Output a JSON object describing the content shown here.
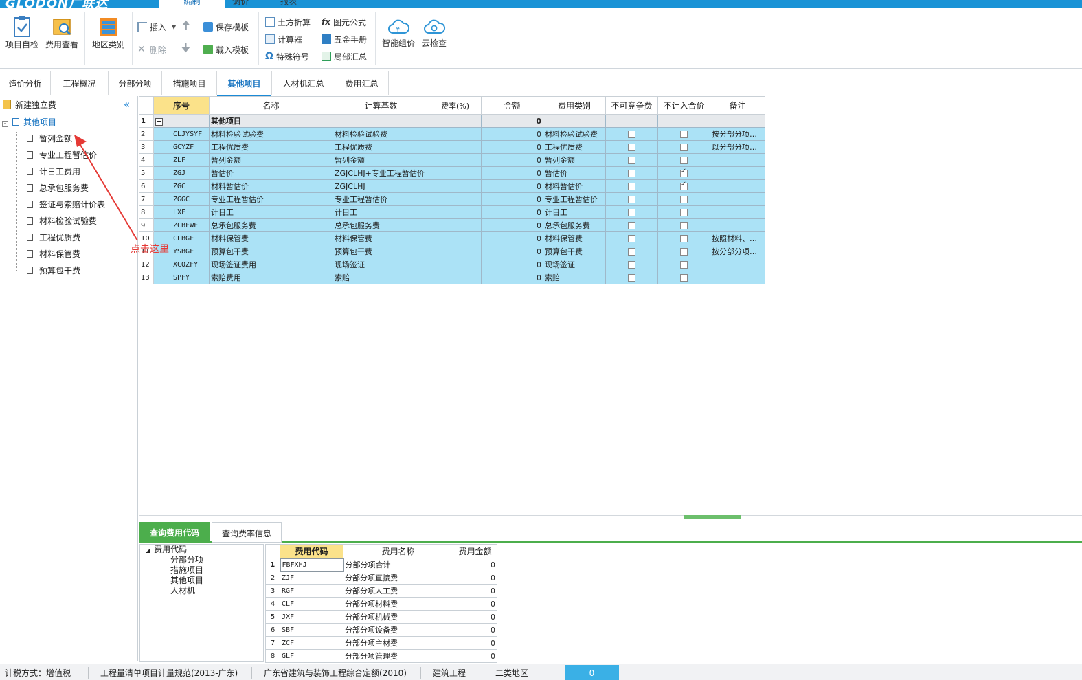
{
  "app": {
    "logo": "GLODON广联达",
    "menu_tabs": [
      "编制",
      "调价",
      "报表"
    ],
    "active_menu_tab": "编制"
  },
  "ribbon": {
    "project_check": "项目自检",
    "fee_view": "费用查看",
    "region_category": "地区类别",
    "insert": "插入",
    "delete": "删除",
    "save_template": "保存模板",
    "load_template": "载入模板",
    "earthwork": "土方折算",
    "calculator": "计算器",
    "special_symbol": "特殊符号",
    "figure_formula": "图元公式",
    "hardware_manual": "五金手册",
    "partial_summary": "局部汇总",
    "smart_pricing": "智能组价",
    "cloud_check": "云检查"
  },
  "nav_tabs": [
    "造价分析",
    "工程概况",
    "分部分项",
    "措施项目",
    "其他项目",
    "人材机汇总",
    "费用汇总"
  ],
  "active_nav_tab": "其他项目",
  "left_tree": {
    "new_fee": "新建独立费",
    "root": "其他项目",
    "children": [
      "暂列金额",
      "专业工程暂估价",
      "计日工费用",
      "总承包服务费",
      "签证与索赔计价表",
      "材料检验试验费",
      "工程优质费",
      "材料保管费",
      "预算包干费"
    ]
  },
  "annotation": "点击这里",
  "main_table": {
    "headers": [
      "序号",
      "名称",
      "计算基数",
      "费率(%)",
      "金额",
      "费用类别",
      "不可竞争费",
      "不计入合价",
      "备注"
    ],
    "row1": {
      "rn": "1",
      "name": "其他项目",
      "amount": "0"
    },
    "rows": [
      {
        "rn": "2",
        "code": "CLJYSYF",
        "name": "材料检验试验费",
        "base": "材料检验试验费",
        "amount": "0",
        "category": "材料检验试验费",
        "nc": false,
        "ni": false,
        "note": "按分部分项…"
      },
      {
        "rn": "3",
        "code": "GCYZF",
        "name": "工程优质费",
        "base": "工程优质费",
        "amount": "0",
        "category": "工程优质费",
        "nc": false,
        "ni": false,
        "note": "以分部分项…"
      },
      {
        "rn": "4",
        "code": "ZLF",
        "name": "暂列金额",
        "base": "暂列金额",
        "amount": "0",
        "category": "暂列金额",
        "nc": false,
        "ni": false,
        "note": ""
      },
      {
        "rn": "5",
        "code": "ZGJ",
        "name": "暂估价",
        "base": "ZGJCLHJ+专业工程暂估价",
        "amount": "0",
        "category": "暂估价",
        "nc": false,
        "ni": true,
        "note": ""
      },
      {
        "rn": "6",
        "code": "ZGC",
        "name": "材料暂估价",
        "base": "ZGJCLHJ",
        "amount": "0",
        "category": "材料暂估价",
        "nc": false,
        "ni": true,
        "note": ""
      },
      {
        "rn": "7",
        "code": "ZGGC",
        "name": "专业工程暂估价",
        "base": "专业工程暂估价",
        "amount": "0",
        "category": "专业工程暂估价",
        "nc": false,
        "ni": false,
        "note": ""
      },
      {
        "rn": "8",
        "code": "LXF",
        "name": "计日工",
        "base": "计日工",
        "amount": "0",
        "category": "计日工",
        "nc": false,
        "ni": false,
        "note": ""
      },
      {
        "rn": "9",
        "code": "ZCBFWF",
        "name": "总承包服务费",
        "base": "总承包服务费",
        "amount": "0",
        "category": "总承包服务费",
        "nc": false,
        "ni": false,
        "note": ""
      },
      {
        "rn": "10",
        "code": "CLBGF",
        "name": "材料保管费",
        "base": "材料保管费",
        "amount": "0",
        "category": "材料保管费",
        "nc": false,
        "ni": false,
        "note": "按照材料、…"
      },
      {
        "rn": "11",
        "code": "YSBGF",
        "name": "预算包干费",
        "base": "预算包干费",
        "amount": "0",
        "category": "预算包干费",
        "nc": false,
        "ni": false,
        "note": "按分部分项…"
      },
      {
        "rn": "12",
        "code": "XCQZFY",
        "name": "现场签证费用",
        "base": "现场签证",
        "amount": "0",
        "category": "现场签证",
        "nc": false,
        "ni": false,
        "note": ""
      },
      {
        "rn": "13",
        "code": "SPFY",
        "name": "索赔费用",
        "base": "索赔",
        "amount": "0",
        "category": "索赔",
        "nc": false,
        "ni": false,
        "note": ""
      }
    ]
  },
  "bottom": {
    "tabs": [
      "查询费用代码",
      "查询费率信息"
    ],
    "tree_root": "费用代码",
    "tree_children": [
      "分部分项",
      "措施项目",
      "其他项目",
      "人材机"
    ],
    "headers": [
      "费用代码",
      "费用名称",
      "费用金额"
    ],
    "rows": [
      {
        "rn": "1",
        "code": "FBFXHJ",
        "name": "分部分项合计",
        "amount": "0"
      },
      {
        "rn": "2",
        "code": "ZJF",
        "name": "分部分项直接费",
        "amount": "0"
      },
      {
        "rn": "3",
        "code": "RGF",
        "name": "分部分项人工费",
        "amount": "0"
      },
      {
        "rn": "4",
        "code": "CLF",
        "name": "分部分项材料费",
        "amount": "0"
      },
      {
        "rn": "5",
        "code": "JXF",
        "name": "分部分项机械费",
        "amount": "0"
      },
      {
        "rn": "6",
        "code": "SBF",
        "name": "分部分项设备费",
        "amount": "0"
      },
      {
        "rn": "7",
        "code": "ZCF",
        "name": "分部分项主材费",
        "amount": "0"
      },
      {
        "rn": "8",
        "code": "GLF",
        "name": "分部分项管理费",
        "amount": "0"
      }
    ]
  },
  "status": {
    "tax_method": "计税方式：增值税",
    "standard": "工程量清单项目计量规范(2013-广东)",
    "quota": "广东省建筑与装饰工程综合定额(2010)",
    "type": "建筑工程",
    "region": "二类地区",
    "total": "0"
  }
}
